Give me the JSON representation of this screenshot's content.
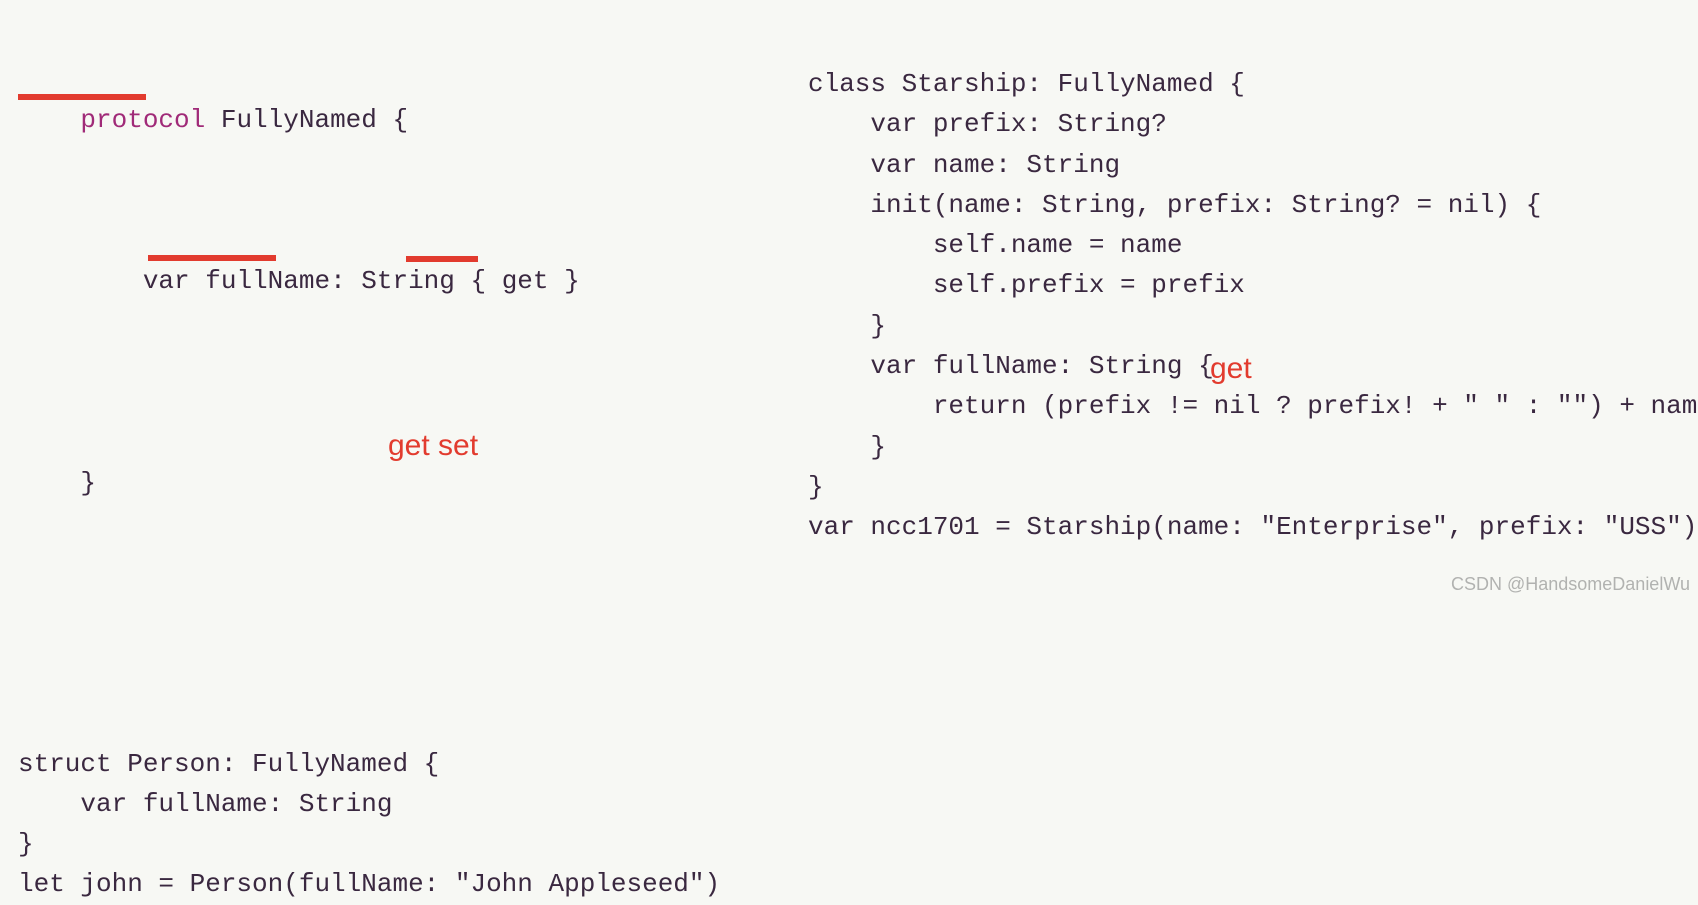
{
  "left": {
    "l1a": "protocol",
    "l1b": " FullyNamed {",
    "l2a": "    var",
    "l2b": " fullName: String { ",
    "l2c": "get",
    "l2d": " }",
    "l3": "}",
    "s1": "struct Person: FullyNamed {",
    "s2": "    var fullName: String",
    "s3": "}",
    "s4": "let john = Person(fullName: \"John Appleseed\")"
  },
  "right": {
    "r1": "class Starship: FullyNamed {",
    "r2": "    var prefix: String?",
    "r3": "    var name: String",
    "r4": "    init(name: String, prefix: String? = nil) {",
    "r5": "        self.name = name",
    "r6": "        self.prefix = prefix",
    "r7": "    }",
    "r8": "    var fullName: String {",
    "r9": "        return (prefix != nil ? prefix! + \" \" : \"\") + name",
    "r10": "    }",
    "r11": "}",
    "r12": "var ncc1701 = Starship(name: \"Enterprise\", prefix: \"USS\")"
  },
  "annotations": {
    "getset": "get set",
    "get": "get"
  },
  "watermark": "CSDN @HandsomeDanielWu"
}
